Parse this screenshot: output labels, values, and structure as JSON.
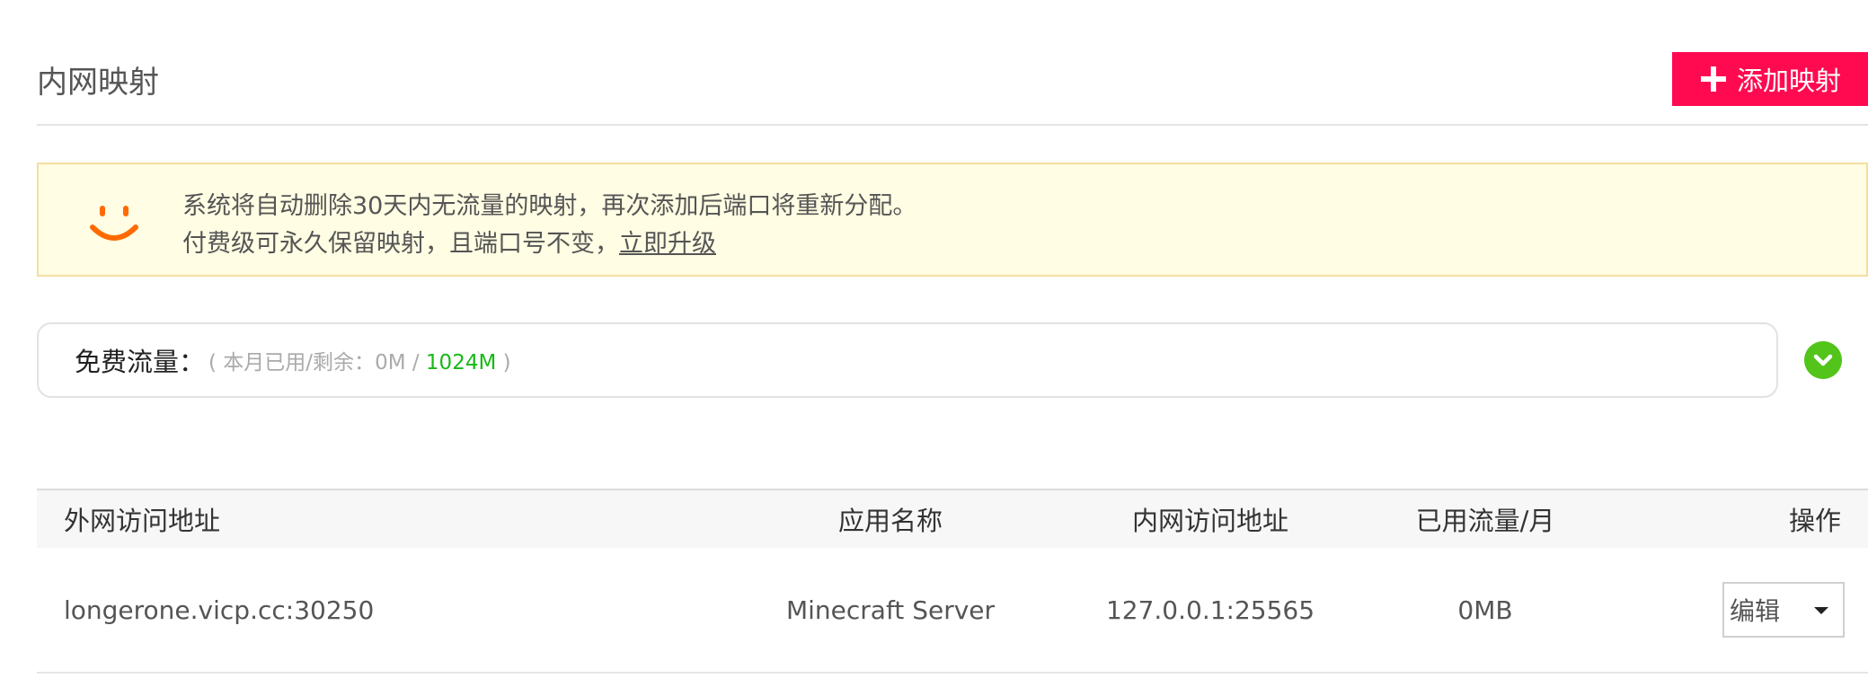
{
  "header": {
    "title": "内网映射",
    "add_button_label": "添加映射",
    "accent_color": "#ff0a50"
  },
  "notice": {
    "icon": "smile-icon",
    "line1": "系统将自动删除30天内无流量的映射，再次添加后端口将重新分配。",
    "line2_prefix": "付费级可永久保留映射，且端口号不变，",
    "upgrade_link": "立即升级"
  },
  "traffic": {
    "label": "免费流量：",
    "detail_prefix": "( 本月已用/剩余：",
    "used": "0M",
    "separator": " / ",
    "remaining": "1024M",
    "detail_suffix": " )",
    "toggle_icon": "chevron-down-icon",
    "remaining_color": "#18b818"
  },
  "table": {
    "columns": [
      "外网访问地址",
      "应用名称",
      "内网访问地址",
      "已用流量/月",
      "操作"
    ],
    "rows": [
      {
        "external_address": "longerone.vicp.cc:30250",
        "app_name": "Minecraft Server",
        "internal_address": "127.0.0.1:25565",
        "traffic_used": "0MB",
        "action": "编辑"
      }
    ]
  }
}
